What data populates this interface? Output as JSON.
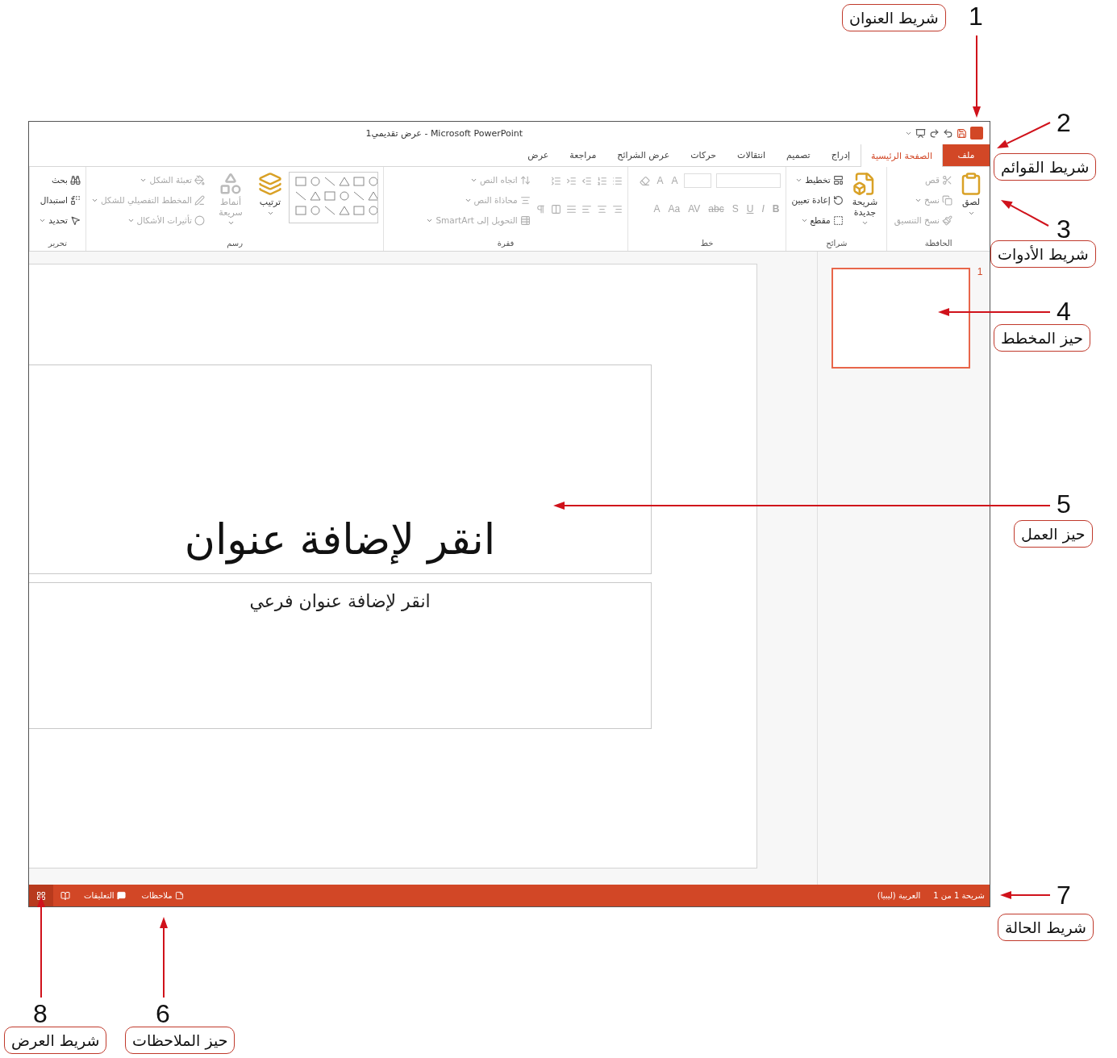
{
  "window": {
    "title": "Microsoft PowerPoint - عرض تقديمي1"
  },
  "tabs": [
    {
      "label": "ملف",
      "kind": "file",
      "selected": false
    },
    {
      "label": "الصفحة الرئيسية",
      "kind": "tab",
      "selected": true
    },
    {
      "label": "إدراج",
      "kind": "tab",
      "selected": false
    },
    {
      "label": "تصميم",
      "kind": "tab",
      "selected": false
    },
    {
      "label": "انتقالات",
      "kind": "tab",
      "selected": false
    },
    {
      "label": "حركات",
      "kind": "tab",
      "selected": false
    },
    {
      "label": "عرض الشرائح",
      "kind": "tab",
      "selected": false
    },
    {
      "label": "مراجعة",
      "kind": "tab",
      "selected": false
    },
    {
      "label": "عرض",
      "kind": "tab",
      "selected": false
    }
  ],
  "ribbon": {
    "groups": [
      {
        "label": "الحافظة",
        "items": [
          {
            "kind": "large",
            "label": "لصق",
            "menu": true,
            "disabled": false
          },
          {
            "kind": "stack",
            "items": [
              {
                "kind": "small",
                "label": "قص",
                "menu": false,
                "disabled": true
              },
              {
                "kind": "small",
                "label": "نسخ",
                "menu": true,
                "disabled": true
              },
              {
                "kind": "small",
                "label": "نسخ التنسيق",
                "menu": false,
                "disabled": true
              }
            ]
          }
        ]
      },
      {
        "label": "شرائح",
        "items": [
          {
            "kind": "large",
            "label": "شريحة جديدة",
            "menu": true,
            "disabled": false
          },
          {
            "kind": "stack",
            "items": [
              {
                "kind": "small",
                "label": "تخطيط",
                "menu": true,
                "disabled": false
              },
              {
                "kind": "small",
                "label": "إعادة تعيين",
                "menu": false,
                "disabled": false
              },
              {
                "kind": "small",
                "label": "مقطع",
                "menu": true,
                "disabled": false
              }
            ]
          }
        ]
      },
      {
        "label": "خط",
        "items": [
          {
            "kind": "stack",
            "items": [
              {
                "kind": "fields",
                "glyphs": [
                  "A",
                  "A"
                ],
                "disabled": true
              },
              {
                "kind": "glyphs",
                "glyphs": [
                  "B",
                  "I",
                  "U",
                  "S",
                  "abc",
                  "AV",
                  "Aa",
                  "A"
                ],
                "disabled": true
              }
            ]
          }
        ]
      },
      {
        "label": "فقرة",
        "items": [
          {
            "kind": "stack",
            "items": [
              {
                "kind": "icons",
                "disabled": true
              },
              {
                "kind": "icons",
                "disabled": true
              }
            ]
          },
          {
            "kind": "stack",
            "items": [
              {
                "kind": "small",
                "label": "اتجاه النص",
                "menu": true,
                "disabled": true
              },
              {
                "kind": "small",
                "label": "محاذاة النص",
                "menu": true,
                "disabled": true
              },
              {
                "kind": "small",
                "label": "التحويل إلى SmartArt",
                "menu": true,
                "disabled": true
              }
            ]
          }
        ]
      },
      {
        "label": "رسم",
        "items": [
          {
            "kind": "gallery"
          },
          {
            "kind": "large",
            "label": "ترتيب",
            "menu": true,
            "disabled": false
          },
          {
            "kind": "large",
            "label": "أنماط سريعة",
            "menu": true,
            "disabled": true
          },
          {
            "kind": "stack",
            "items": [
              {
                "kind": "small",
                "label": "تعبئة الشكل",
                "menu": true,
                "disabled": true
              },
              {
                "kind": "small",
                "label": "المخطط التفصيلي للشكل",
                "menu": true,
                "disabled": true
              },
              {
                "kind": "small",
                "label": "تأثيرات الأشكال",
                "menu": true,
                "disabled": true
              }
            ]
          }
        ]
      },
      {
        "label": "تحرير",
        "items": [
          {
            "kind": "stack",
            "items": [
              {
                "kind": "small",
                "label": "بحث",
                "menu": false,
                "disabled": false
              },
              {
                "kind": "small",
                "label": "استبدال",
                "menu": false,
                "disabled": false
              },
              {
                "kind": "small",
                "label": "تحديد",
                "menu": true,
                "disabled": false
              }
            ]
          }
        ]
      }
    ]
  },
  "slides_pane": {
    "thumbnails": [
      {
        "number": "1",
        "selected": true
      }
    ]
  },
  "slide": {
    "title_placeholder": "انقر لإضافة عنوان",
    "subtitle_placeholder": "انقر لإضافة عنوان فرعي"
  },
  "status_bar": {
    "slide_info": "شريحة 1 من 1",
    "language": "العربية (ليبيا)",
    "notes": "ملاحظات",
    "comments": "التعليقات",
    "views": [
      {
        "kind": "sorter",
        "selected": true
      },
      {
        "kind": "reading",
        "selected": false
      }
    ]
  },
  "callouts": [
    {
      "number": "1",
      "label": "شريط العنوان"
    },
    {
      "number": "2",
      "label": "شريط القوائم"
    },
    {
      "number": "3",
      "label": "شريط الأدوات"
    },
    {
      "number": "4",
      "label": "حيز المخطط"
    },
    {
      "number": "5",
      "label": "حيز العمل"
    },
    {
      "number": "6",
      "label": "حيز الملاحظات"
    },
    {
      "number": "7",
      "label": "شريط الحالة"
    },
    {
      "number": "8",
      "label": "شريط العرض"
    }
  ]
}
